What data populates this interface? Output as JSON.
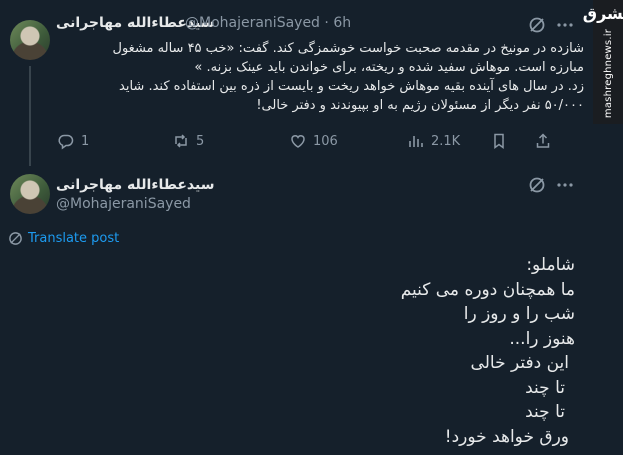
{
  "watermark": {
    "logo": "مشرق",
    "url": "mashreghnews.ir"
  },
  "tweet1": {
    "author_name": "سیدعطاءالله مهاجرانی",
    "handle": "@MohajeraniSayed",
    "separator": "·",
    "time": "6h",
    "lines": [
      "شازده در مونیخ در مقدمه صحبت خواست خوشمزگی کند. گفت: «خب ۴۵ ساله مشغول",
      "مبارزه است. موهاش سفید شده و ریخته، برای خواندن باید عینک بزنه. »",
      "زد. در سال های آینده بقیه موهاش خواهد ریخت و بایست از ذره بین استفاده کند.  شاید",
      "۵۰/۰۰۰ نفر دیگر از مسئولان رژیم به او بپیوندند و  دفتر خالی!"
    ],
    "stats": {
      "replies": "1",
      "reposts": "5",
      "likes": "106",
      "views": "2.1K"
    }
  },
  "tweet2": {
    "author_name": "سیدعطاءالله مهاجرانی",
    "handle": "@MohajeraniSayed",
    "translate_label": "Translate post",
    "lines": [
      "شاملو:",
      "ما همچنان دوره می کنیم",
      "شب را و روز را",
      "هنوز را...",
      "این دفتر خالی",
      "تا چند",
      "تا چند",
      "ورق خواهد خورد!"
    ]
  },
  "colors": {
    "background": "#15202b",
    "text": "#e7e9ea",
    "muted": "#8b98a5",
    "accent": "#1d9bf0"
  }
}
